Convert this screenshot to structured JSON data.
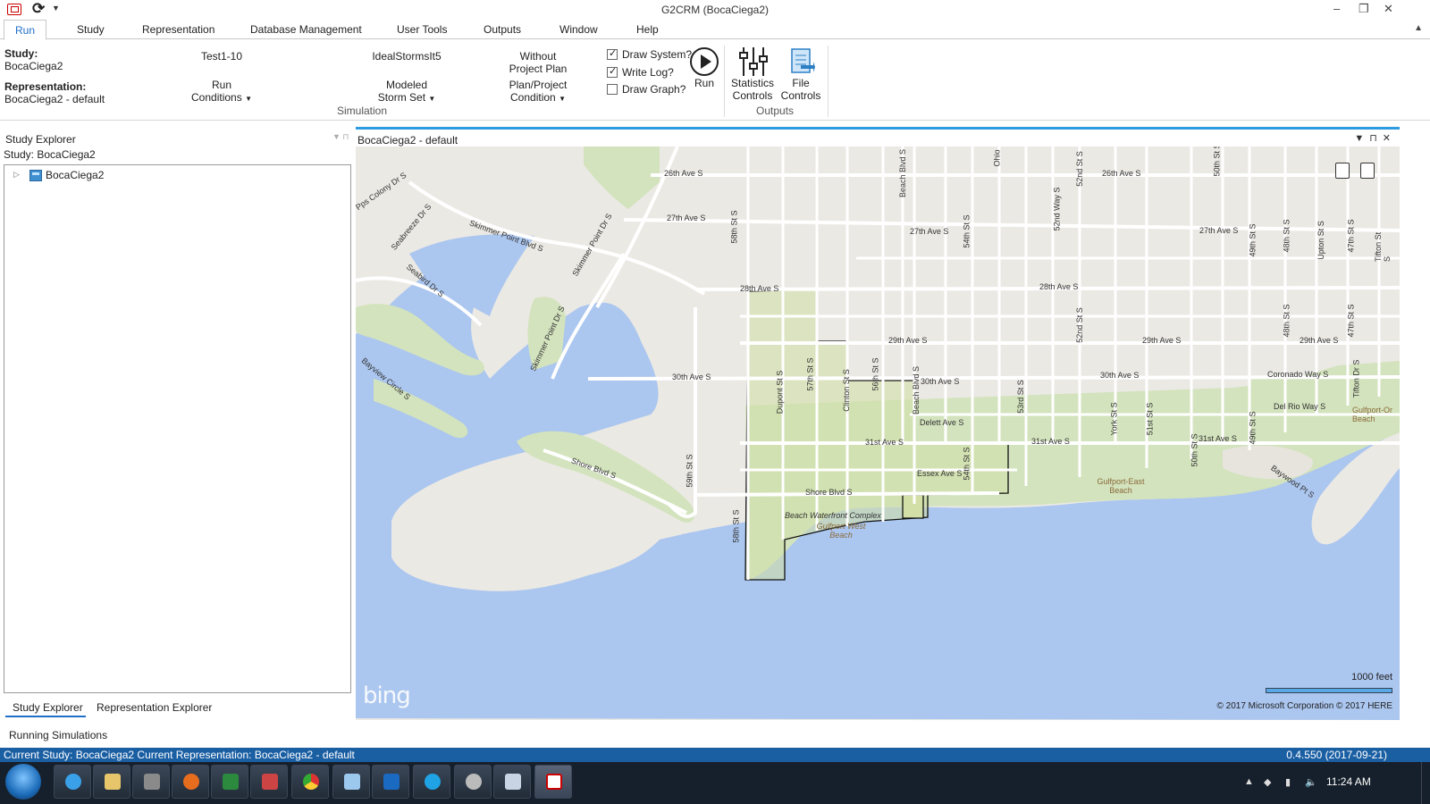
{
  "window": {
    "title": "G2CRM (BocaCiega2)",
    "controls": {
      "minimize": "–",
      "restore": "❐",
      "close": "✕"
    }
  },
  "ribbon_tabs": [
    "Run",
    "Study",
    "Representation",
    "Database Management",
    "User Tools",
    "Outputs",
    "Window",
    "Help"
  ],
  "ribbon": {
    "study_label": "Study:",
    "study_value": "BocaCiega2",
    "representation_label": "Representation:",
    "representation_value": "BocaCiega2 - default",
    "run_conditions_value": "Test1-10",
    "run_conditions_label_1": "Run",
    "run_conditions_label_2": "Conditions",
    "storm_set_value": "IdealStormsIt5",
    "storm_set_label_1": "Modeled",
    "storm_set_label_2": "Storm Set",
    "plan_value_1": "Without",
    "plan_value_2": "Project Plan",
    "plan_label_1": "Plan/Project",
    "plan_label_2": "Condition",
    "group_simulation": "Simulation",
    "draw_system": {
      "label": "Draw System?",
      "checked": true
    },
    "write_log": {
      "label": "Write Log?",
      "checked": true
    },
    "draw_graph": {
      "label": "Draw Graph?",
      "checked": false
    },
    "run_button": "Run",
    "statistics_1": "Statistics",
    "statistics_2": "Controls",
    "file_1": "File",
    "file_2": "Controls",
    "group_outputs": "Outputs"
  },
  "explorer": {
    "header": "Study Explorer",
    "study_line": "Study: BocaCiega2",
    "tree_root": "BocaCiega2",
    "tab_study": "Study Explorer",
    "tab_representation": "Representation Explorer"
  },
  "running_simulations": "Running Simulations",
  "map": {
    "title": "BocaCiega2 - default",
    "bing": "bing",
    "scale": "1000 feet",
    "copyright": "© 2017 Microsoft Corporation   © 2017 HERE",
    "labels": {
      "a26": "26th Ave S",
      "a26b": "26th Ave S",
      "a27": "27th Ave S",
      "a27b": "27th Ave S",
      "a27c": "27th Ave S",
      "a28": "28th Ave S",
      "a28b": "28th Ave S",
      "a29": "29th Ave S",
      "a29b": "29th Ave S",
      "a29c": "29th Ave S",
      "a30": "30th Ave S",
      "a30b": "30th Ave S",
      "a30c": "30th Ave S",
      "a31": "31st Ave S",
      "a31b": "31st Ave S",
      "a31c": "31st Ave S",
      "shore": "Shore Blvd S",
      "shore2": "Shore Blvd S",
      "delett": "Delett Ave S",
      "essex": "Essex Ave S",
      "coronado": "Coronado Way S",
      "delrio": "Del Rio Way S",
      "skimmer": "Skimmer Point Blvd S",
      "skimmerdr": "Skimmer Point Dr S",
      "skimmerdr2": "Skimmer Point Dr S",
      "seabreeze": "Seabreeze Dr S",
      "seabird": "Seabird Dr S",
      "bayview": "Bayview Circle S",
      "colony": "Pps Colony Dr S",
      "baywood": "Baywood Pt S",
      "s58": "58th St S",
      "s58b": "58th St S",
      "s59": "59th St S",
      "dupont": "Dupont St S",
      "s57": "57th St S",
      "clinton": "Clinton St S",
      "s56": "56th St S",
      "beach": "Beach Blvd S",
      "beach2": "Beach Blvd S",
      "s54": "54th St S",
      "s54b": "54th St S",
      "s53": "53rd St S",
      "s52": "52nd St S",
      "s52b": "52nd St S",
      "s52way": "52nd Way S",
      "york": "York St S",
      "s51": "51st St S",
      "s50": "50th St S",
      "s49": "49th St S",
      "s49b": "49th St S",
      "s48": "48th St S",
      "s48b": "48th St S",
      "upton": "Upton St S",
      "s47": "47th St S",
      "s47b": "47th St S",
      "tifton": "Tifton St S",
      "tifton2": "Tifton Dr S",
      "ohio": "Ohio",
      "s50b": "50th St S",
      "waterfront": "Beach Waterfront Complex",
      "gwb": "Gulfport West Beach",
      "geb": "Gulfport-East Beach",
      "gob": "Gulfport-Or Beach"
    }
  },
  "status": {
    "left": "Current Study: BocaCiega2   Current Representation: BocaCiega2 - default",
    "version": "0.4.550 (2017-09-21)"
  },
  "taskbar": {
    "clock": "11:24 AM"
  },
  "colors": {
    "accent": "#1e6fc9",
    "status_bar": "#1b5fa3",
    "water": "#abc6ef",
    "park": "#d3e3bd",
    "land": "#ebe9e4"
  }
}
